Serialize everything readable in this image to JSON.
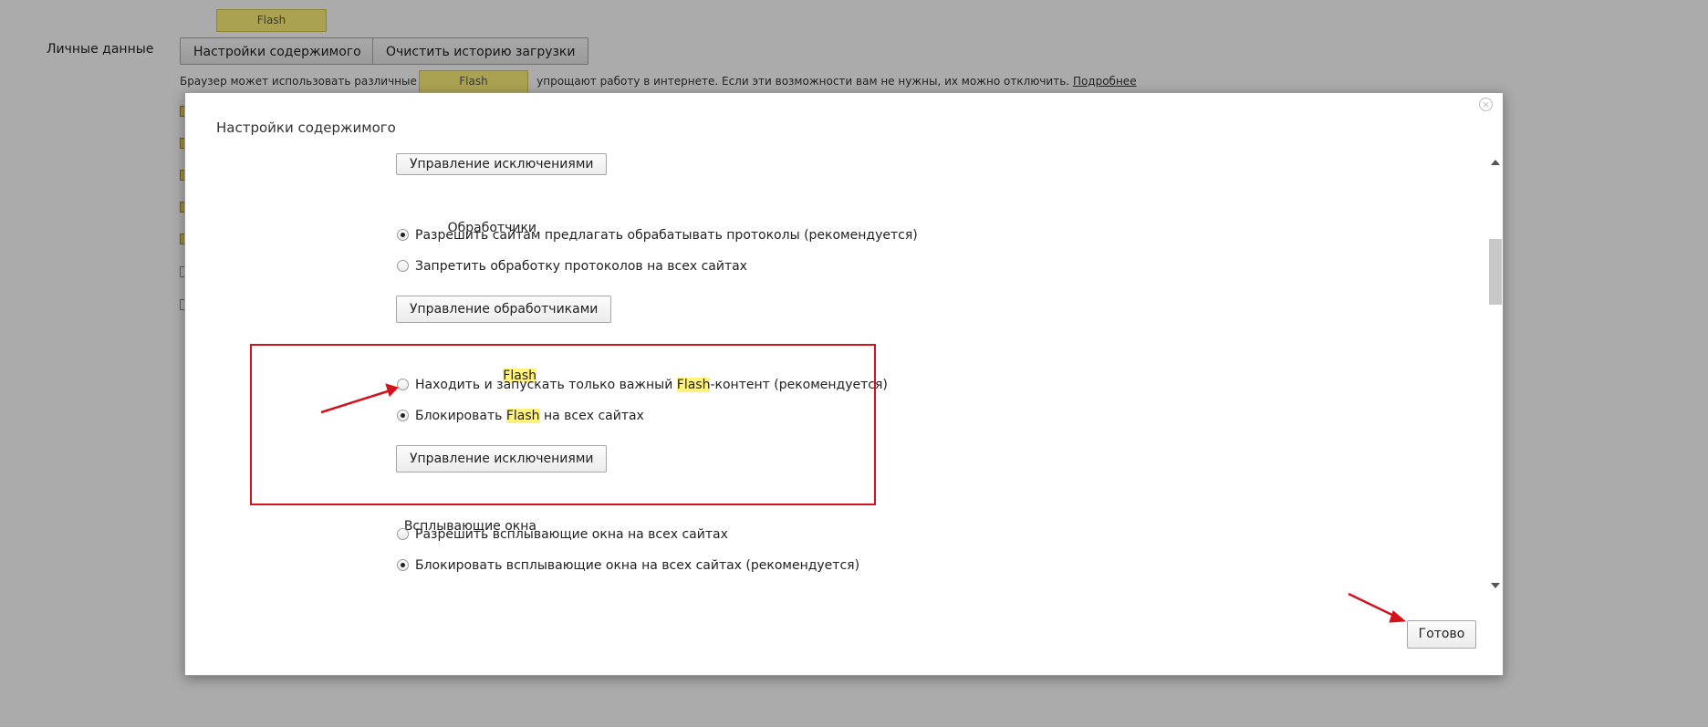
{
  "background": {
    "section_label": "Личные данные",
    "buttons": [
      "Настройки содержимого",
      "Очистить историю загрузки"
    ],
    "description": "Браузер может использовать различные ве",
    "description_tail": "упрощают работу в интернете. Если эти возможности вам не нужны, их можно отключить.",
    "more_link": "Подробнее",
    "tooltips": [
      "Flash",
      "Flash"
    ]
  },
  "dialog": {
    "title": "Настройки содержимого",
    "close_glyph": "×",
    "top_button": "Управление исключениями",
    "handlers": {
      "label": "Обработчики",
      "options": [
        {
          "label": "Разрешить сайтам предлагать обрабатывать протоколы (рекомендуется)",
          "selected": true
        },
        {
          "label": "Запретить обработку протоколов на всех сайтах",
          "selected": false
        }
      ],
      "button": "Управление обработчиками"
    },
    "flash": {
      "label": "Flash",
      "option1_pre": "Находить и запускать только важный ",
      "option1_hl": "Flash",
      "option1_post": "-контент (рекомендуется)",
      "option2_pre": "Блокировать ",
      "option2_hl": "Flash",
      "option2_post": " на всех сайтах",
      "selected_option": 2,
      "button": "Управление исключениями"
    },
    "popups": {
      "label": "Всплывающие окна",
      "options": [
        {
          "label": "Разрешить всплывающие окна на всех сайтах",
          "selected": false
        },
        {
          "label": "Блокировать всплывающие окна на всех сайтах (рекомендуется)",
          "selected": true
        }
      ]
    },
    "done_button": "Готово"
  },
  "colors": {
    "highlight": "#fff27a",
    "annotation_red": "#d3131b"
  }
}
